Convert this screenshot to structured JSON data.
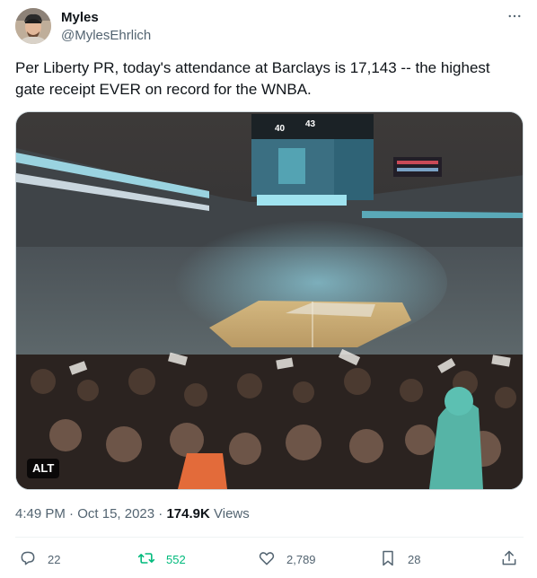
{
  "author": {
    "name": "Myles",
    "handle": "@MylesEhrlich"
  },
  "tweet": {
    "text": "Per Liberty PR, today's attendance at Barclays is 17,143 -- the highest gate receipt EVER on record for the WNBA.",
    "media_badge": "ALT",
    "scoreboard_left": "40",
    "scoreboard_right": "43"
  },
  "meta": {
    "time": "4:49 PM",
    "separator": "·",
    "date": "Oct 15, 2023",
    "views_count": "174.9K",
    "views_label": "Views"
  },
  "actions": {
    "replies": "22",
    "reposts": "552",
    "likes": "2,789",
    "bookmarks": "28"
  },
  "colors": {
    "text": "#0f1419",
    "secondary": "#536471",
    "repost_active": "#00ba7c",
    "border": "#cfd9de"
  },
  "icons": [
    "more-icon",
    "reply-icon",
    "repost-icon",
    "like-icon",
    "bookmark-icon",
    "share-icon"
  ]
}
